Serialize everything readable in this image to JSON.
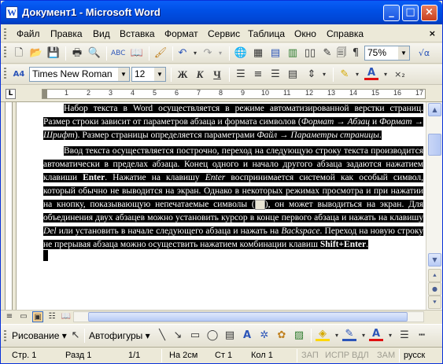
{
  "window": {
    "title": "Документ1 - Microsoft Word",
    "controls": {
      "minimize": "_",
      "maximize": "□",
      "close": "×"
    }
  },
  "menubar": {
    "items": [
      "Файл",
      "Правка",
      "Вид",
      "Вставка",
      "Формат",
      "Сервис",
      "Таблица",
      "Окно",
      "Справка"
    ],
    "close_doc": "×"
  },
  "standard_toolbar": {
    "icons": [
      "new-document-icon",
      "open-icon",
      "save-icon",
      "print-icon",
      "print-preview-icon",
      "spelling-icon",
      "research-icon",
      "format-painter-icon",
      "undo-icon",
      "redo-icon",
      "hyperlink-icon",
      "tables-borders-icon",
      "insert-table-icon",
      "insert-excel-icon",
      "columns-icon",
      "drawing-icon",
      "document-map-icon",
      "show-formatting-icon"
    ],
    "zoom": "75%",
    "equation_label": "√α"
  },
  "formatting_toolbar": {
    "style_icon": "A4",
    "font": "Times New Roman",
    "font_size": "12",
    "bold": "Ж",
    "italic": "К",
    "underline": "Ч",
    "subscript": "×₂"
  },
  "ruler": {
    "tab_selector": "L",
    "numbers": [
      "1",
      "2",
      "3",
      "4",
      "5",
      "6",
      "7",
      "8",
      "9",
      "10",
      "11",
      "12",
      "13",
      "14",
      "15",
      "16",
      "17"
    ]
  },
  "document": {
    "p1_a": "Набор текста в Word осуществляется в режиме автоматизированной верстки страниц. Размер строки зависит от параметров абзаца и формата символов (",
    "p1_i1": "Формат → Абзац",
    "p1_b": " и ",
    "p1_i2": "Формат → Шрифт",
    "p1_c": "). Размер страницы определяется параметрами ",
    "p1_i3": "Файл → Параметры страницы",
    "p1_d": ".",
    "p2_a": "Ввод текста осуществляется построчно, переход на следующую строку текста производится автоматически в пределах абзаца. Конец одного и начало другого абзаца задаются нажатием клавиши ",
    "p2_b1": "Enter",
    "p2_b": ". Нажатие на клавишу ",
    "p2_i1": "Enter",
    "p2_c": " воспринимается системой как особый символ, который обычно не выводится на экран. Однако в некоторых режимах просмотра и при нажатии на кнопку, показывающую непечатаемые символы (",
    "p2_d": "), он может выводиться на экран. Для объединения двух абзацев можно установить курсор в конце первого абзаца и нажать на клавишу ",
    "p2_i2": "Del",
    "p2_e": " или установить в начале следующего абзаца и нажать на ",
    "p2_i3": "Backspace",
    "p2_f": ". Переход на новую строку не прерывая абзаца можно осуществить нажатием комбинации клавиш ",
    "p2_b2": "Shift+Enter",
    "p2_g": "."
  },
  "drawing_toolbar": {
    "draw_label": "Рисование ▾",
    "autoshapes_label": "Автофигуры ▾"
  },
  "statusbar": {
    "page": "Стр. 1",
    "section": "Разд 1",
    "pages": "1/1",
    "at": "На 2см",
    "line": "Ст 1",
    "col": "Кол 1",
    "rec": "ЗАП",
    "trk": "ИСПР",
    "ext": "ВДЛ",
    "ovr": "ЗАМ",
    "lang": "русск"
  }
}
